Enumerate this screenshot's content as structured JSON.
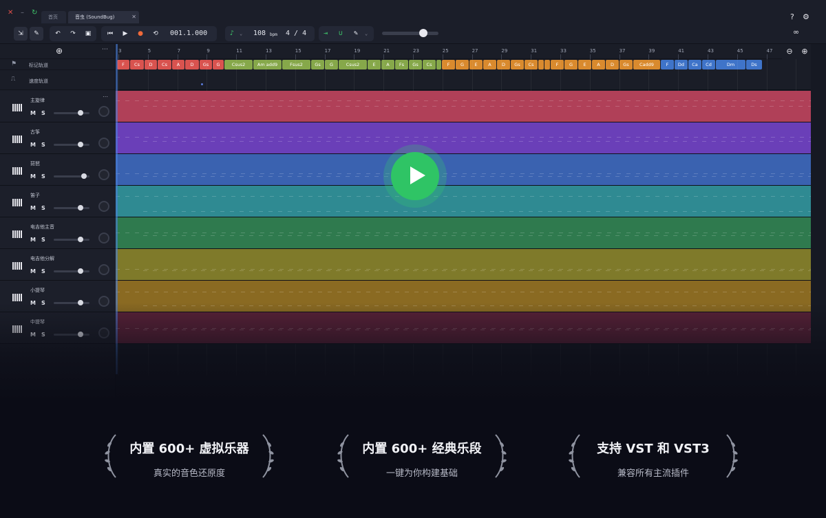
{
  "tabs": [
    {
      "label": "首页"
    },
    {
      "label": "音虫 (SoundBug)"
    }
  ],
  "toolbar": {
    "position": "001.1.000",
    "bpm": "108",
    "bpm_unit": "bpm",
    "time_signature": "4 / 4",
    "master_volume": 0.7
  },
  "icons": [
    "close-icon",
    "minimize-icon",
    "refresh-icon",
    "help-icon",
    "settings-icon",
    "loop-icon",
    "zoom-out-icon",
    "zoom-in-icon",
    "add-track-icon",
    "play-icon",
    "record-icon",
    "metronome-icon",
    "magnet-icon",
    "pencil-icon",
    "undo-icon",
    "redo-icon",
    "save-icon"
  ],
  "left_panel": {
    "marker_lane_label": "标记轨道",
    "tempo_lane_label": "速度轨道",
    "tracks": [
      {
        "name": "主旋律",
        "mute": "M",
        "solo": "S",
        "volume": 0.75
      },
      {
        "name": "古筝",
        "mute": "M",
        "solo": "S",
        "volume": 0.75
      },
      {
        "name": "琵琶",
        "mute": "M",
        "solo": "S",
        "volume": 0.85
      },
      {
        "name": "笛子",
        "mute": "M",
        "solo": "S",
        "volume": 0.75
      },
      {
        "name": "电吉他主音",
        "mute": "M",
        "solo": "S",
        "volume": 0.75
      },
      {
        "name": "电吉他分解",
        "mute": "M",
        "solo": "S",
        "volume": 0.75
      },
      {
        "name": "小提琴",
        "mute": "M",
        "solo": "S",
        "volume": 0.75
      },
      {
        "name": "中提琴",
        "mute": "M",
        "solo": "S",
        "volume": 0.75
      }
    ]
  },
  "ruler": [
    "3",
    "5",
    "7",
    "9",
    "11",
    "13",
    "15",
    "17",
    "19",
    "21",
    "23",
    "25",
    "27",
    "29",
    "31",
    "33",
    "35",
    "37",
    "39",
    "41",
    "43",
    "45",
    "47"
  ],
  "chords": [
    {
      "label": "F",
      "color": "red"
    },
    {
      "label": "Cs",
      "color": "red"
    },
    {
      "label": "D",
      "color": "red"
    },
    {
      "label": "Cs",
      "color": "red"
    },
    {
      "label": "A",
      "color": "red"
    },
    {
      "label": "D",
      "color": "red"
    },
    {
      "label": "Gs",
      "color": "red"
    },
    {
      "label": "G",
      "color": "red"
    },
    {
      "label": "Csus2",
      "color": "green"
    },
    {
      "label": "Am add9",
      "color": "green"
    },
    {
      "label": "Fsus2",
      "color": "green"
    },
    {
      "label": "Gs",
      "color": "green"
    },
    {
      "label": "G",
      "color": "green"
    },
    {
      "label": "Csus2",
      "color": "green"
    },
    {
      "label": "E",
      "color": "green"
    },
    {
      "label": "A",
      "color": "green"
    },
    {
      "label": "Fs",
      "color": "green"
    },
    {
      "label": "Gs",
      "color": "green"
    },
    {
      "label": "Cs",
      "color": "green"
    },
    {
      "label": "",
      "color": "green"
    },
    {
      "label": "F",
      "color": "orange"
    },
    {
      "label": "G",
      "color": "orange"
    },
    {
      "label": "E",
      "color": "orange"
    },
    {
      "label": "A",
      "color": "orange"
    },
    {
      "label": "D",
      "color": "orange"
    },
    {
      "label": "Gs",
      "color": "orange"
    },
    {
      "label": "Cs",
      "color": "orange"
    },
    {
      "label": "",
      "color": "orange"
    },
    {
      "label": "",
      "color": "orange"
    },
    {
      "label": "F",
      "color": "orange"
    },
    {
      "label": "G",
      "color": "orange"
    },
    {
      "label": "E",
      "color": "orange"
    },
    {
      "label": "A",
      "color": "orange"
    },
    {
      "label": "D",
      "color": "orange"
    },
    {
      "label": "Gs",
      "color": "orange"
    },
    {
      "label": "Cadd9",
      "color": "orange"
    },
    {
      "label": "F",
      "color": "blue"
    },
    {
      "label": "Dd",
      "color": "blue"
    },
    {
      "label": "Ca",
      "color": "blue"
    },
    {
      "label": "Cd",
      "color": "blue"
    },
    {
      "label": "Dm",
      "color": "blue"
    },
    {
      "label": "Ds",
      "color": "blue"
    }
  ],
  "track_colors": [
    "#b04058",
    "#6a3fb8",
    "#3a62b0",
    "#2f8a92",
    "#2f7a4e",
    "#7f7a2a",
    "#8a6a22",
    "#5a2238"
  ],
  "features": [
    {
      "title": "内置 600+ 虚拟乐器",
      "subtitle": "真实的音色还原度"
    },
    {
      "title": "内置 600+ 经典乐段",
      "subtitle": "一键为你构建基础"
    },
    {
      "title": "支持 VST 和 VST3",
      "subtitle": "兼容所有主流插件"
    }
  ]
}
